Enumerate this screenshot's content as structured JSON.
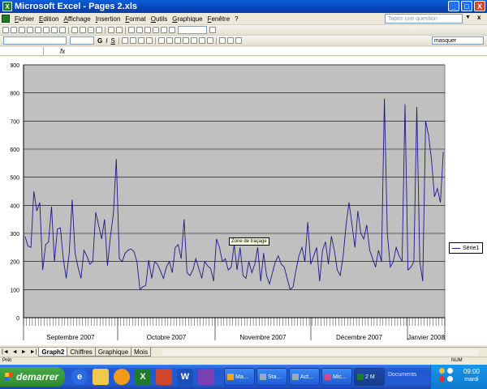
{
  "window": {
    "title": "Microsoft Excel - Pages 2.xls",
    "controls": [
      "_",
      "□",
      "X"
    ]
  },
  "menu": {
    "items": [
      "Fichier",
      "Edition",
      "Affichage",
      "Insertion",
      "Format",
      "Outils",
      "Graphique",
      "Fenêtre",
      "?"
    ],
    "ask_placeholder": "Tapez une question",
    "close_label": "x"
  },
  "toolbar": {
    "chart_object": "masquer",
    "bold": "G",
    "italic": "I",
    "underline": "S"
  },
  "formula_bar": {
    "fx": "fx"
  },
  "chart_data": {
    "type": "line",
    "title": "",
    "ylim": [
      0,
      900
    ],
    "yticks": [
      0,
      100,
      200,
      300,
      400,
      500,
      600,
      700,
      800,
      900
    ],
    "month_labels": [
      "Septembre 2007",
      "Octobre 2007",
      "Novembre 2007",
      "Décembre 2007",
      "Janvier 2008"
    ],
    "grid": true,
    "legend_position": "right",
    "background": "#c0c0c0",
    "line_color": "#1a1a8c",
    "series": [
      {
        "name": "Série1",
        "values": [
          290,
          255,
          250,
          450,
          380,
          410,
          170,
          260,
          270,
          395,
          200,
          315,
          320,
          210,
          140,
          230,
          420,
          230,
          180,
          140,
          240,
          220,
          190,
          200,
          375,
          330,
          280,
          350,
          185,
          290,
          370,
          565,
          210,
          200,
          230,
          240,
          245,
          235,
          200,
          100,
          110,
          115,
          205,
          140,
          200,
          190,
          165,
          140,
          180,
          200,
          160,
          250,
          260,
          210,
          350,
          160,
          150,
          170,
          210,
          175,
          140,
          200,
          185,
          175,
          130,
          280,
          250,
          200,
          210,
          170,
          180,
          260,
          170,
          250,
          150,
          140,
          200,
          160,
          190,
          250,
          130,
          230,
          150,
          120,
          160,
          200,
          220,
          190,
          180,
          140,
          100,
          110,
          170,
          220,
          250,
          200,
          340,
          190,
          220,
          250,
          130,
          240,
          270,
          190,
          290,
          240,
          170,
          150,
          220,
          330,
          410,
          330,
          250,
          380,
          300,
          280,
          330,
          240,
          210,
          180,
          240,
          200,
          780,
          300,
          180,
          200,
          250,
          220,
          200,
          760,
          170,
          180,
          200,
          750,
          200,
          130,
          700,
          650,
          560,
          430,
          460,
          410,
          590
        ]
      }
    ],
    "tooltip": "Zone de traçage"
  },
  "sheets": {
    "nav": [
      "|◄",
      "◄",
      "►",
      "►|"
    ],
    "tabs": [
      "Graph2",
      "Chiffres",
      "Graphique",
      "Mois"
    ],
    "active": "Graph2"
  },
  "status": {
    "ready": "Prêt",
    "num": "NUM"
  },
  "taskbar": {
    "start_label": "demarrer",
    "tasks": [
      "Ma...",
      "Sta...",
      "Act...",
      "Mic...",
      "2 M"
    ],
    "documents": "Documents",
    "time": "09:00",
    "day": "mardi"
  },
  "colors": {
    "titlebar": "#0a45b8",
    "taskbar": "#245ad3",
    "start": "#2f8a2f",
    "plot_bg": "#c0c0c0",
    "series": "#1a1a8c"
  }
}
